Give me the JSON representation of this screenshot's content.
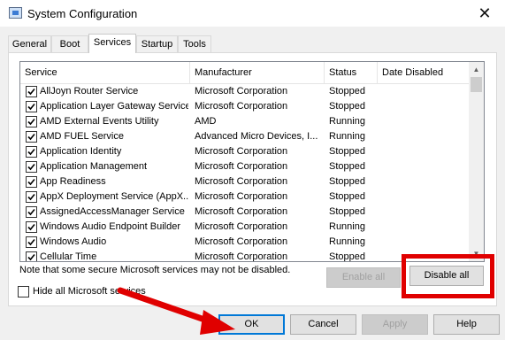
{
  "window": {
    "title": "System Configuration",
    "close": "✕"
  },
  "tabs": [
    {
      "label": "General"
    },
    {
      "label": "Boot"
    },
    {
      "label": "Services"
    },
    {
      "label": "Startup"
    },
    {
      "label": "Tools"
    }
  ],
  "active_tab": "Services",
  "columns": {
    "service": "Service",
    "manufacturer": "Manufacturer",
    "status": "Status",
    "date_disabled": "Date Disabled"
  },
  "services": [
    {
      "name": "AllJoyn Router Service",
      "manufacturer": "Microsoft Corporation",
      "status": "Stopped",
      "date_disabled": "",
      "checked": true
    },
    {
      "name": "Application Layer Gateway Service",
      "manufacturer": "Microsoft Corporation",
      "status": "Stopped",
      "date_disabled": "",
      "checked": true
    },
    {
      "name": "AMD External Events Utility",
      "manufacturer": "AMD",
      "status": "Running",
      "date_disabled": "",
      "checked": true
    },
    {
      "name": "AMD FUEL Service",
      "manufacturer": "Advanced Micro Devices, I...",
      "status": "Running",
      "date_disabled": "",
      "checked": true
    },
    {
      "name": "Application Identity",
      "manufacturer": "Microsoft Corporation",
      "status": "Stopped",
      "date_disabled": "",
      "checked": true
    },
    {
      "name": "Application Management",
      "manufacturer": "Microsoft Corporation",
      "status": "Stopped",
      "date_disabled": "",
      "checked": true
    },
    {
      "name": "App Readiness",
      "manufacturer": "Microsoft Corporation",
      "status": "Stopped",
      "date_disabled": "",
      "checked": true
    },
    {
      "name": "AppX Deployment Service (AppX...",
      "manufacturer": "Microsoft Corporation",
      "status": "Stopped",
      "date_disabled": "",
      "checked": true
    },
    {
      "name": "AssignedAccessManager Service",
      "manufacturer": "Microsoft Corporation",
      "status": "Stopped",
      "date_disabled": "",
      "checked": true
    },
    {
      "name": "Windows Audio Endpoint Builder",
      "manufacturer": "Microsoft Corporation",
      "status": "Running",
      "date_disabled": "",
      "checked": true
    },
    {
      "name": "Windows Audio",
      "manufacturer": "Microsoft Corporation",
      "status": "Running",
      "date_disabled": "",
      "checked": true
    },
    {
      "name": "Cellular Time",
      "manufacturer": "Microsoft Corporation",
      "status": "Stopped",
      "date_disabled": "",
      "checked": true
    }
  ],
  "note": "Note that some secure Microsoft services may not be disabled.",
  "buttons": {
    "enable_all": "Enable all",
    "disable_all": "Disable all",
    "ok": "OK",
    "cancel": "Cancel",
    "apply": "Apply",
    "help": "Help"
  },
  "hide_ms": {
    "label": "Hide all Microsoft services",
    "checked": false
  },
  "icons": {
    "app": "system-config-icon",
    "close": "close-icon",
    "checkbox_checked": "check-icon",
    "scroll_up": "scroll-up-icon",
    "scroll_down": "scroll-down-icon"
  },
  "colors": {
    "highlight": "#e00000",
    "default_button_border": "#0078d7",
    "panel": "#ffffff",
    "window": "#f0f0f0"
  }
}
